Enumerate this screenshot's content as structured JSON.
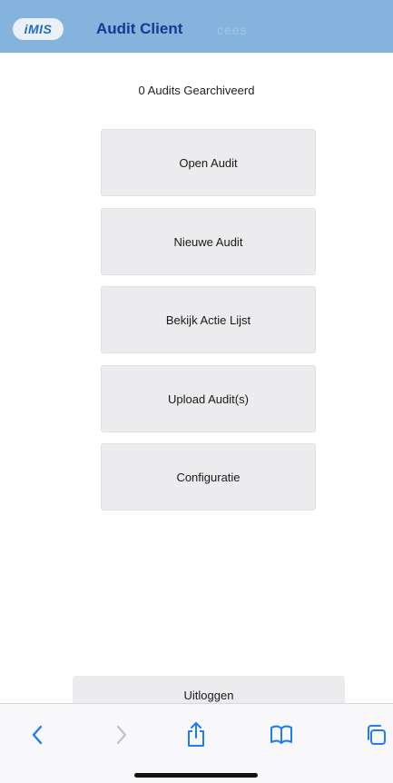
{
  "header": {
    "logo_text": "iMIS",
    "app_title": "Audit Client",
    "user_name": "cees",
    "background_color": "#84b4de"
  },
  "status": {
    "archived_text": "0 Audits Gearchiveerd"
  },
  "menu": {
    "buttons": [
      {
        "label": "Open Audit"
      },
      {
        "label": "Nieuwe Audit"
      },
      {
        "label": "Bekijk Actie Lijst"
      },
      {
        "label": "Upload Audit(s)"
      },
      {
        "label": "Configuratie"
      }
    ]
  },
  "logout": {
    "label": "Uitloggen"
  },
  "browser_toolbar": {
    "accent_color": "#1f7cf5",
    "disabled_color": "#c4c4c8",
    "icons": [
      "back-icon",
      "forward-icon",
      "share-icon",
      "bookmarks-icon",
      "tabs-icon"
    ]
  }
}
